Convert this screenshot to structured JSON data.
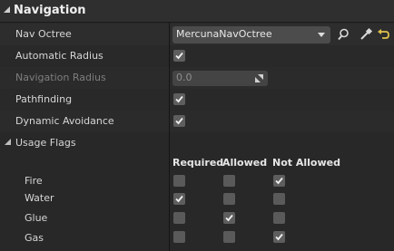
{
  "section": {
    "title": "Navigation"
  },
  "rows": {
    "nav_octree": {
      "label": "Nav Octree",
      "value": "MercunaNavOctree"
    },
    "automatic_radius": {
      "label": "Automatic Radius",
      "checked": true
    },
    "navigation_radius": {
      "label": "Navigation Radius",
      "value": "0.0"
    },
    "pathfinding": {
      "label": "Pathfinding",
      "checked": true
    },
    "dynamic_avoidance": {
      "label": "Dynamic Avoidance",
      "checked": true
    }
  },
  "usage_flags": {
    "label": "Usage Flags",
    "columns": [
      "Required",
      "Allowed",
      "Not Allowed"
    ],
    "items": [
      {
        "label": "Fire",
        "values": [
          false,
          false,
          true
        ]
      },
      {
        "label": "Water",
        "values": [
          true,
          false,
          false
        ]
      },
      {
        "label": "Glue",
        "values": [
          false,
          true,
          false
        ]
      },
      {
        "label": "Gas",
        "values": [
          false,
          false,
          true
        ]
      }
    ]
  },
  "icons": {
    "browse": "magnifier-icon",
    "pick": "eyedropper-icon",
    "reset": "reset-arrow-icon"
  },
  "colors": {
    "accent_reset": "#e0c24a",
    "panel": "#2a2a2a",
    "header": "#2f2f2f"
  }
}
